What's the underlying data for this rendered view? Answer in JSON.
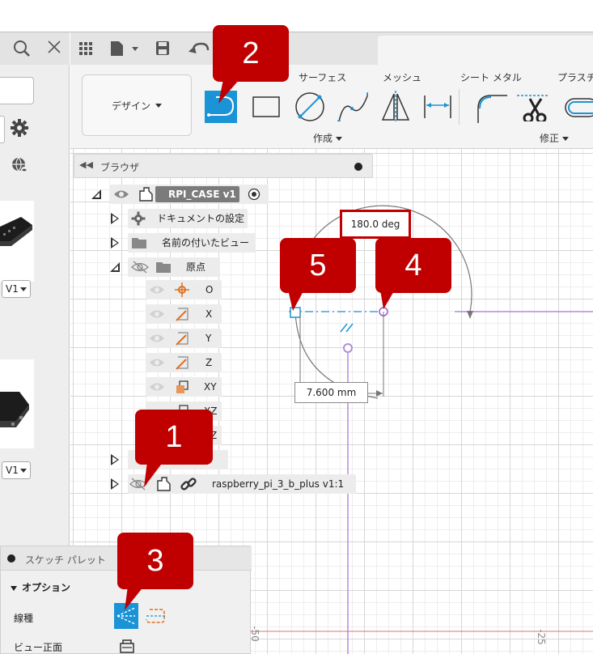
{
  "ribbon": {
    "design_label": "デザイン",
    "tabs": [
      "サーフェス",
      "メッシュ",
      "シート メタル",
      "プラスチ"
    ],
    "group_create": "作成",
    "group_modify": "修正"
  },
  "browser": {
    "title": "ブラウザ",
    "root_name": "RPI_CASE v1",
    "items": {
      "doc_settings": "ドキュメントの設定",
      "named_views": "名前の付いたビュー",
      "origin": "原点",
      "origin_o": "O",
      "origin_x": "X",
      "origin_y": "Y",
      "origin_z": "Z",
      "plane_xy": "XY",
      "plane_xz": "XZ",
      "plane_yz": "Z",
      "sketches": "ッチ",
      "component": "raspberry_pi_3_b_plus v1:1"
    }
  },
  "left_panel": {
    "version_1": "V1",
    "version_2": "V1"
  },
  "canvas": {
    "angle_dim": "180.0 deg",
    "linear_dim": "7.600 mm",
    "ruler_1": "-50",
    "ruler_2": "-25"
  },
  "palette": {
    "title": "スケッチ パレット",
    "options_label": "オプション",
    "linetype_label": "線種",
    "lookat_label": "ビュー正面"
  },
  "callouts": [
    "1",
    "2",
    "3",
    "4",
    "5"
  ],
  "colors": {
    "accent_blue": "#1a94d6",
    "callout_red": "#c00000",
    "sketch_purple": "#b48ce0"
  }
}
